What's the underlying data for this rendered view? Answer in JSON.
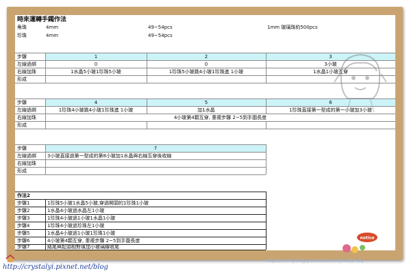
{
  "title": "時來運轉手鐲作法",
  "materials": {
    "row1": {
      "label": "角珠",
      "size": "4mm",
      "qty": "49~54pcs",
      "note": "1mm 玻璃珠約500pcs"
    },
    "row2": {
      "label": "珍珠",
      "size": "4mm",
      "qty": "49~54pcs"
    }
  },
  "row_labels": {
    "step": "步驟",
    "left": "左線過綁",
    "right": "右線加珠",
    "form": "形成"
  },
  "table1": {
    "steps": [
      "1",
      "2",
      "3"
    ],
    "left": [
      "0",
      "0",
      "3小玻"
    ],
    "right": [
      "1水晶5小玻1珍珠5小玻",
      "1珍珠5小玻跳4小玻1珍珠進 1小玻",
      "1水晶1小玻互穿"
    ]
  },
  "table2": {
    "steps": [
      "4",
      "5",
      "6"
    ],
    "left": [
      "1珍珠4小玻跳4小玻1珍珠進 1小玻",
      "加1水晶",
      "1珍珠直接第一型成的第一小玻加3小玻"
    ],
    "right_merged": "4小玻第4顆互穿, 重複步驟 2~5到手圍長度"
  },
  "table3": {
    "step": "7",
    "left": "3小玻直接過第一型成的第8小玻加1水晶與右線互穿後收線"
  },
  "method2": {
    "title": "作法2",
    "rows": [
      {
        "label": "步驟1",
        "text": "1珍珠5小玻1水晶5小玻,穿過開頭的1珍珠1小玻"
      },
      {
        "label": "步驟2",
        "text": "1水晶4小玻過水晶左1小玻"
      },
      {
        "label": "步驟3",
        "text": "1珍珠4小玻過1小玻1水晶1小玻"
      },
      {
        "label": "步驟4",
        "text": "1珍珠4小玻過珍珠左1小玻"
      },
      {
        "label": "步驟5",
        "text": "1水晶4小玻過1小玻1珍珠1小玻"
      },
      {
        "label": "步驟6",
        "text": "4小玻第4顆互穿, 重複步驟 2~5到手圍長度"
      },
      {
        "label": "步驟7",
        "text": "結尾與起頭相對填加小玻璃線收尾"
      }
    ]
  },
  "footer": {
    "left_url": "http://crystalyi.pixnet.net/blog",
    "right_url": "http://tw.myblog.yahoo.com/crystalyi-diy",
    "sticker": "notice"
  },
  "colors": {
    "cork": "#c9a471",
    "header_band": "#ccf4f8",
    "url": "#1f3f9a"
  }
}
